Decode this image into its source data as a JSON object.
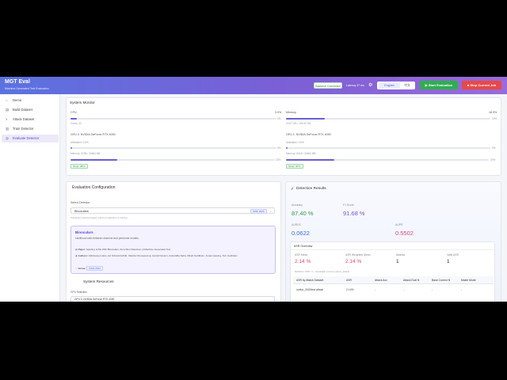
{
  "app": {
    "title": "MGT Eval",
    "subtitle": "Machine-Generated Text Evaluation"
  },
  "header": {
    "status": "Backend Connected",
    "latency": "Latency 37 ms",
    "lang_en": "English",
    "lang_zh": "中文",
    "start_label": "Start Evaluation",
    "stop_label": "Stop Current Job"
  },
  "sidebar": {
    "items": [
      {
        "label": "Demo",
        "icon": "home-icon"
      },
      {
        "label": "Build Dataset",
        "icon": "file-icon"
      },
      {
        "label": "Attack Dataset",
        "icon": "bolt-icon"
      },
      {
        "label": "Train Detector",
        "icon": "book-icon"
      },
      {
        "label": "Evaluate Detector",
        "icon": "target-icon",
        "active": true
      }
    ]
  },
  "system_monitor": {
    "title": "System Monitor",
    "cpu_label": "CPU",
    "cpu_value": "3.0%",
    "cpu_pct": "0%",
    "cpu_cores": "Cores: 32",
    "cpu_fraction": 0.03,
    "mem_label": "Memory",
    "mem_value": "18.9%",
    "mem_pct": "19%",
    "mem_detail": "23.87 GB / 125.52 GB",
    "mem_fraction": 0.189,
    "gpus": [
      {
        "name": "GPU 0: NVIDIA GeForce RTX 4090",
        "util": "Utilization: 0.0%",
        "util_pct": "0%",
        "util_fraction": 0.0,
        "mem": "Memory: 5786 / 24564 MB",
        "mem_pct": "23%",
        "mem_fraction": 0.23,
        "temp": "Temp: 38°C"
      },
      {
        "name": "GPU 1: NVIDIA GeForce RTX 4090",
        "util": "Utilization: 0.0%",
        "util_pct": "0%",
        "util_fraction": 0.0,
        "mem": "Memory: 6018 / 24564 MB",
        "mem_pct": "24%",
        "mem_fraction": 0.24,
        "temp": "Temp: 33°C"
      }
    ]
  },
  "eval_config": {
    "title": "Evaluation Configuration",
    "select_label": "Select Detector",
    "selected": "Binoculars",
    "venue_tag": "ICML 2024",
    "hint": "Pretrained: detector-based, used for evaluation or training.",
    "info": {
      "name": "Binoculars",
      "desc": "Likelihood ratio between observer and performer models.",
      "paper_label": "Paper:",
      "paper": "Spotting LLMs With Binoculars: Zero-Shot Detection of Machine-Generated Text",
      "authors_label": "Authors:",
      "authors": "Abhimanyu Hans, Avi Schwarzschild, Valeriia Cherepanova, Hamid Kazemi, Aniruddha Saha, Micah Goldblum, Jonas Geiping, Tom Goldstein",
      "venue_label": "Venue:",
      "venue": "ICML 2024"
    },
    "sys_res_title": "System Resources",
    "gpu_selection": "GPU Selection",
    "gpu_option": "GPU 0: NVIDIA GeForce RTX 4090"
  },
  "results": {
    "title": "Detection Results",
    "metrics": [
      {
        "label": "Accuracy",
        "value": "87.40 %",
        "color": "#2f9a55"
      },
      {
        "label": "F1 Score",
        "value": "91.68 %",
        "color": "#7c4fd8"
      },
      {
        "label": "AUROC",
        "value": "0.0622",
        "color": "#3b6fd8"
      },
      {
        "label": "AUPR",
        "value": "0.5502",
        "color": "#e0457b"
      }
    ],
    "asr": {
      "title": "ASR Overview",
      "cells": [
        {
          "label": "ASR Mean",
          "value": "2.14 %",
          "color": "#e0457b"
        },
        {
          "label": "ASR Weighted Mean",
          "value": "2.14 %",
          "color": "#e0457b"
        },
        {
          "label": "Attacks",
          "value": "1",
          "color": "#222222"
        },
        {
          "label": "Valid ASR",
          "value": "1",
          "color": "#222222"
        }
      ],
      "definition": "Definition: ASR = 1 - Acc(attack | correct_before_attack)",
      "headers": [
        "ASR by Attack Dataset",
        "ASR",
        "Attack Acc",
        "Attack Eval N",
        "Base Correct N",
        "Match Mode"
      ],
      "rows": [
        [
          "outfox_2000test.attack",
          "2.14%",
          "-",
          "-",
          "-",
          "-"
        ]
      ]
    }
  }
}
